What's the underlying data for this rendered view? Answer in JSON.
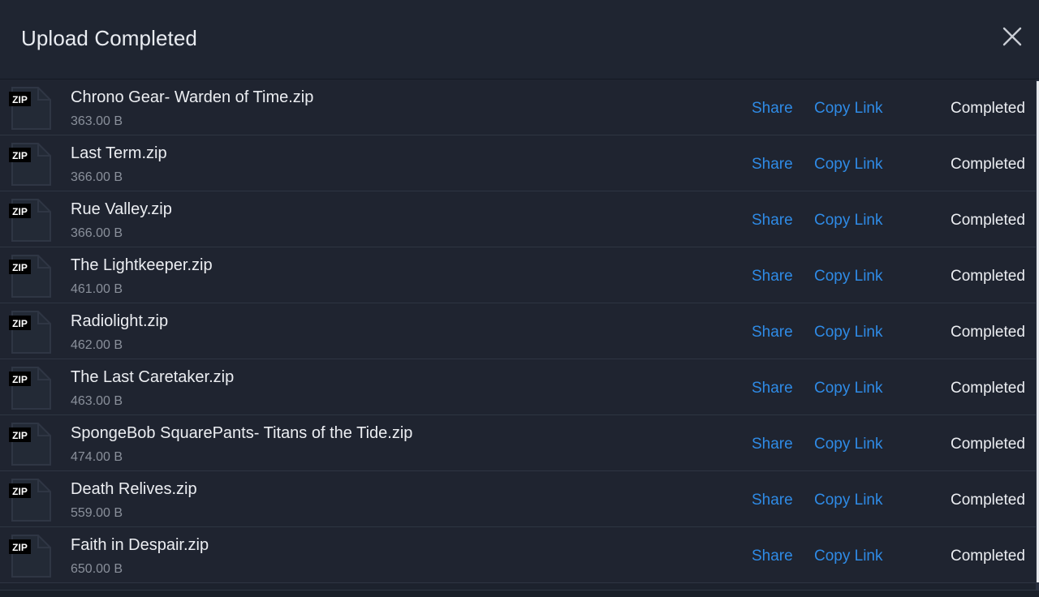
{
  "dialog": {
    "title": "Upload Completed",
    "close_icon": "close-icon"
  },
  "labels": {
    "share": "Share",
    "copy_link": "Copy Link"
  },
  "files": [
    {
      "icon_label": "ZIP",
      "name": "Chrono Gear- Warden of Time.zip",
      "size": "363.00 B",
      "status": "Completed"
    },
    {
      "icon_label": "ZIP",
      "name": "Last Term.zip",
      "size": "366.00 B",
      "status": "Completed"
    },
    {
      "icon_label": "ZIP",
      "name": "Rue Valley.zip",
      "size": "366.00 B",
      "status": "Completed"
    },
    {
      "icon_label": "ZIP",
      "name": "The Lightkeeper.zip",
      "size": "461.00 B",
      "status": "Completed"
    },
    {
      "icon_label": "ZIP",
      "name": "Radiolight.zip",
      "size": "462.00 B",
      "status": "Completed"
    },
    {
      "icon_label": "ZIP",
      "name": "The Last Caretaker.zip",
      "size": "463.00 B",
      "status": "Completed"
    },
    {
      "icon_label": "ZIP",
      "name": "SpongeBob SquarePants- Titans of the Tide.zip",
      "size": "474.00 B",
      "status": "Completed"
    },
    {
      "icon_label": "ZIP",
      "name": "Death Relives.zip",
      "size": "559.00 B",
      "status": "Completed"
    },
    {
      "icon_label": "ZIP",
      "name": "Faith in Despair.zip",
      "size": "650.00 B",
      "status": "Completed"
    }
  ],
  "colors": {
    "background": "#1f2531",
    "link": "#2f8be6",
    "text": "#eceef2",
    "muted": "#8a909b"
  }
}
